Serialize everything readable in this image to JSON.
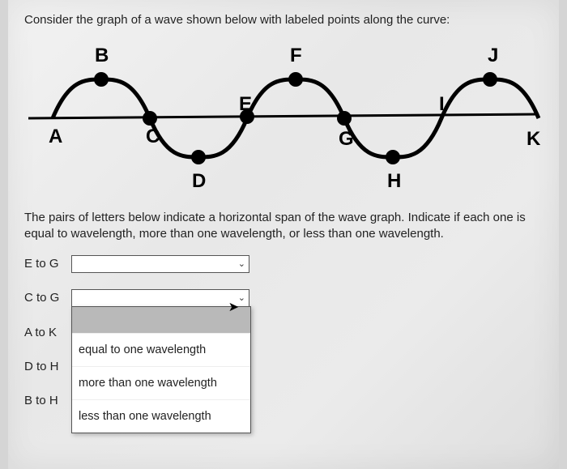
{
  "prompt": "Consider the graph of a wave shown below with labeled points along the curve:",
  "instruction": "The pairs of letters below indicate a horizontal span of the wave graph. Indicate if each one is equal to wavelength, more than one wavelength, or less than one wavelength.",
  "wave_labels": {
    "A": "A",
    "B": "B",
    "C": "C",
    "D": "D",
    "E": "E",
    "F": "F",
    "G": "G",
    "H": "H",
    "I": "I",
    "J": "J",
    "K": "K"
  },
  "rows": [
    {
      "label": "E to G"
    },
    {
      "label": "C to G"
    },
    {
      "label": "A to K"
    },
    {
      "label": "D to H"
    },
    {
      "label": "B to H"
    }
  ],
  "options": {
    "blank": "",
    "eq": "equal to one wavelength",
    "more": "more than one wavelength",
    "less": "less than one wavelength"
  },
  "chart_data": {
    "type": "line",
    "title": "",
    "xlabel": "",
    "ylabel": "",
    "description": "Sinusoidal wave with axis through A-C-E-G-I-K, crests at B,F,J and troughs at D,H. Approx 2.5 full wavelengths shown.",
    "labeled_points": [
      {
        "id": "A",
        "phase": "axis-up-crossing",
        "wavelength_index": 0.0
      },
      {
        "id": "B",
        "phase": "crest",
        "wavelength_index": 0.25
      },
      {
        "id": "C",
        "phase": "axis-down-crossing",
        "wavelength_index": 0.5
      },
      {
        "id": "D",
        "phase": "trough",
        "wavelength_index": 0.75
      },
      {
        "id": "E",
        "phase": "axis-up-crossing",
        "wavelength_index": 1.0
      },
      {
        "id": "F",
        "phase": "crest",
        "wavelength_index": 1.25
      },
      {
        "id": "G",
        "phase": "axis-down-crossing",
        "wavelength_index": 1.5
      },
      {
        "id": "H",
        "phase": "trough",
        "wavelength_index": 1.75
      },
      {
        "id": "I",
        "phase": "axis-up-crossing",
        "wavelength_index": 2.0
      },
      {
        "id": "J",
        "phase": "crest",
        "wavelength_index": 2.25
      },
      {
        "id": "K",
        "phase": "axis-down-crossing",
        "wavelength_index": 2.5
      }
    ]
  }
}
